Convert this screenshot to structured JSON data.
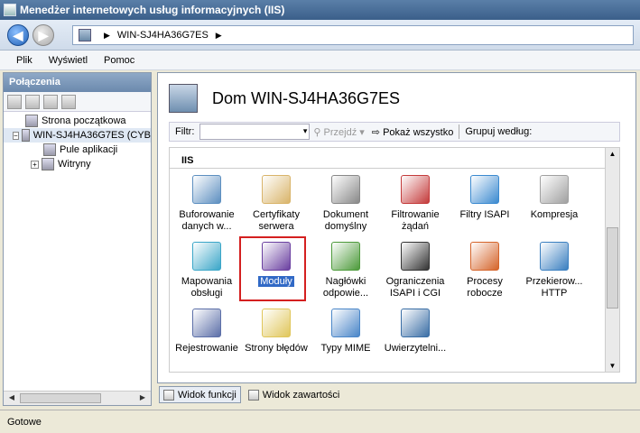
{
  "window": {
    "title": "Menedżer internetowych usług informacyjnych (IIS)"
  },
  "address": {
    "server": "WIN-SJ4HA36G7ES"
  },
  "menu": [
    "Plik",
    "Wyświetl",
    "Pomoc"
  ],
  "connections": {
    "header": "Połączenia",
    "tree": [
      {
        "label": "Strona początkowa"
      },
      {
        "label": "WIN-SJ4HA36G7ES (CYB"
      },
      {
        "label": "Pule aplikacji"
      },
      {
        "label": "Witryny"
      }
    ]
  },
  "main": {
    "title": "Dom WIN-SJ4HA36G7ES",
    "filter_label": "Filtr:",
    "go_label": "Przejdź",
    "show_all_label": "Pokaż wszystko",
    "group_label": "Grupuj według:",
    "section": "IIS",
    "features": [
      {
        "line1": "Buforowanie",
        "line2": "danych w...",
        "icon": "output-caching-icon",
        "color": "#5d8fc0"
      },
      {
        "line1": "Certyfikaty",
        "line2": "serwera",
        "icon": "server-certificates-icon",
        "color": "#d9b46a"
      },
      {
        "line1": "Dokument",
        "line2": "domyślny",
        "icon": "default-document-icon",
        "color": "#888888"
      },
      {
        "line1": "Filtrowanie",
        "line2": "żądań",
        "icon": "request-filtering-icon",
        "color": "#c43b3b"
      },
      {
        "line1": "Filtry ISAPI",
        "line2": "",
        "icon": "isapi-filters-icon",
        "color": "#3b8ad0"
      },
      {
        "line1": "Kompresja",
        "line2": "",
        "icon": "compression-icon",
        "color": "#a0a0a0"
      },
      {
        "line1": "Mapowania",
        "line2": "obsługi",
        "icon": "handler-mappings-icon",
        "color": "#3aa6c8"
      },
      {
        "line1": "Moduły",
        "line2": "",
        "icon": "modules-icon",
        "color": "#6a3fa0"
      },
      {
        "line1": "Nagłówki",
        "line2": "odpowie...",
        "icon": "response-headers-icon",
        "color": "#4c9a3a"
      },
      {
        "line1": "Ograniczenia",
        "line2": "ISAPI i CGI",
        "icon": "isapi-cgi-restrictions-icon",
        "color": "#333333"
      },
      {
        "line1": "Procesy",
        "line2": "robocze",
        "icon": "worker-processes-icon",
        "color": "#d5642a"
      },
      {
        "line1": "Przekierow...",
        "line2": "HTTP",
        "icon": "http-redirect-icon",
        "color": "#3a7fc0"
      },
      {
        "line1": "Rejestrowanie",
        "line2": "",
        "icon": "logging-icon",
        "color": "#5c6fa8"
      },
      {
        "line1": "Strony błędów",
        "line2": "",
        "icon": "error-pages-icon",
        "color": "#e0c65a"
      },
      {
        "line1": "Typy MIME",
        "line2": "",
        "icon": "mime-types-icon",
        "color": "#4a86c8"
      },
      {
        "line1": "Uwierzytelni...",
        "line2": "",
        "icon": "authentication-icon",
        "color": "#3a6ea5"
      }
    ]
  },
  "view_tabs": {
    "features": "Widok funkcji",
    "content": "Widok zawartości"
  },
  "status": {
    "text": "Gotowe"
  }
}
